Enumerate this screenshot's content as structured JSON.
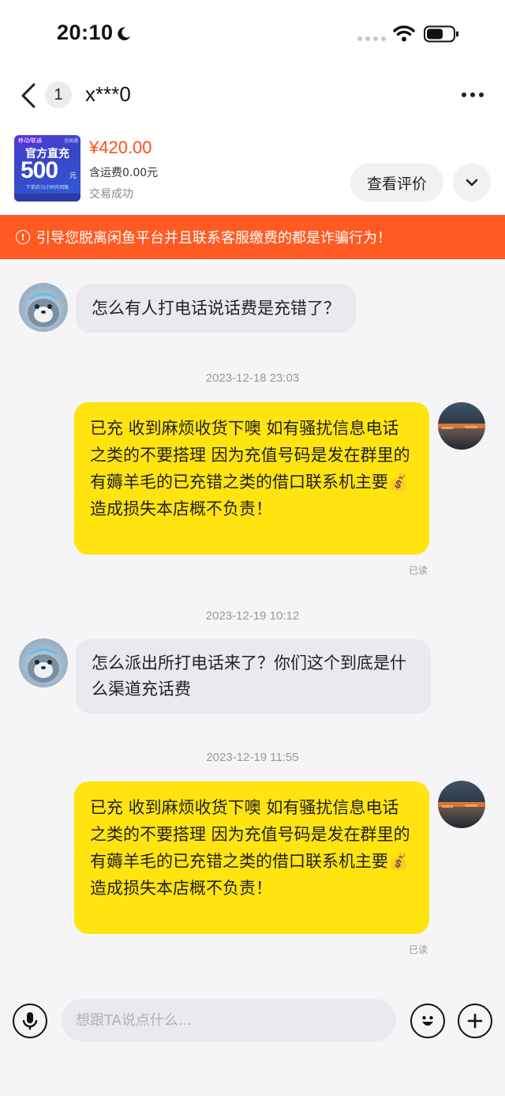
{
  "status_bar": {
    "time": "20:10"
  },
  "nav": {
    "unread_count": "1",
    "title": "x***0"
  },
  "product": {
    "image_text": {
      "tag_left": "移动/联通",
      "tag_right": "全国通",
      "headline": "官方直充",
      "amount": "500",
      "unit": "元",
      "sub": "下单后72小时内到账"
    },
    "price": "¥420.00",
    "shipping": "含运费0.00元",
    "status": "交易成功",
    "review_button": "查看评价"
  },
  "warning": {
    "text": "引导您脱离闲鱼平台并且联系客服缴费的都是诈骗行为！"
  },
  "messages": [
    {
      "side": "left",
      "text": "怎么有人打电话说话费是充错了？"
    },
    {
      "timestamp": "2023-12-18 23:03"
    },
    {
      "side": "right",
      "text": "已充 收到麻烦收货下噢 如有骚扰信息电话之类的不要搭理 因为充值号码是发在群里的 有薅羊毛的已充错之类的借口联系机主要💰 造成损失本店概不负责！",
      "read": "已读"
    },
    {
      "timestamp": "2023-12-19 10:12"
    },
    {
      "side": "left",
      "text": "怎么派出所打电话来了？你们这个到底是什么渠道充话费"
    },
    {
      "timestamp": "2023-12-19 11:55"
    },
    {
      "side": "right",
      "text": "已充 收到麻烦收货下噢 如有骚扰信息电话之类的不要搭理 因为充值号码是发在群里的 有薅羊毛的已充错之类的借口联系机主要💰 造成损失本店概不负责！",
      "read": "已读"
    }
  ],
  "input": {
    "placeholder": "想跟TA说点什么..."
  },
  "colors": {
    "accent_orange": "#ff5a22",
    "price_red": "#ff4d1a",
    "bubble_yellow": "#ffe40f",
    "bubble_gray": "#e9e9ee"
  }
}
